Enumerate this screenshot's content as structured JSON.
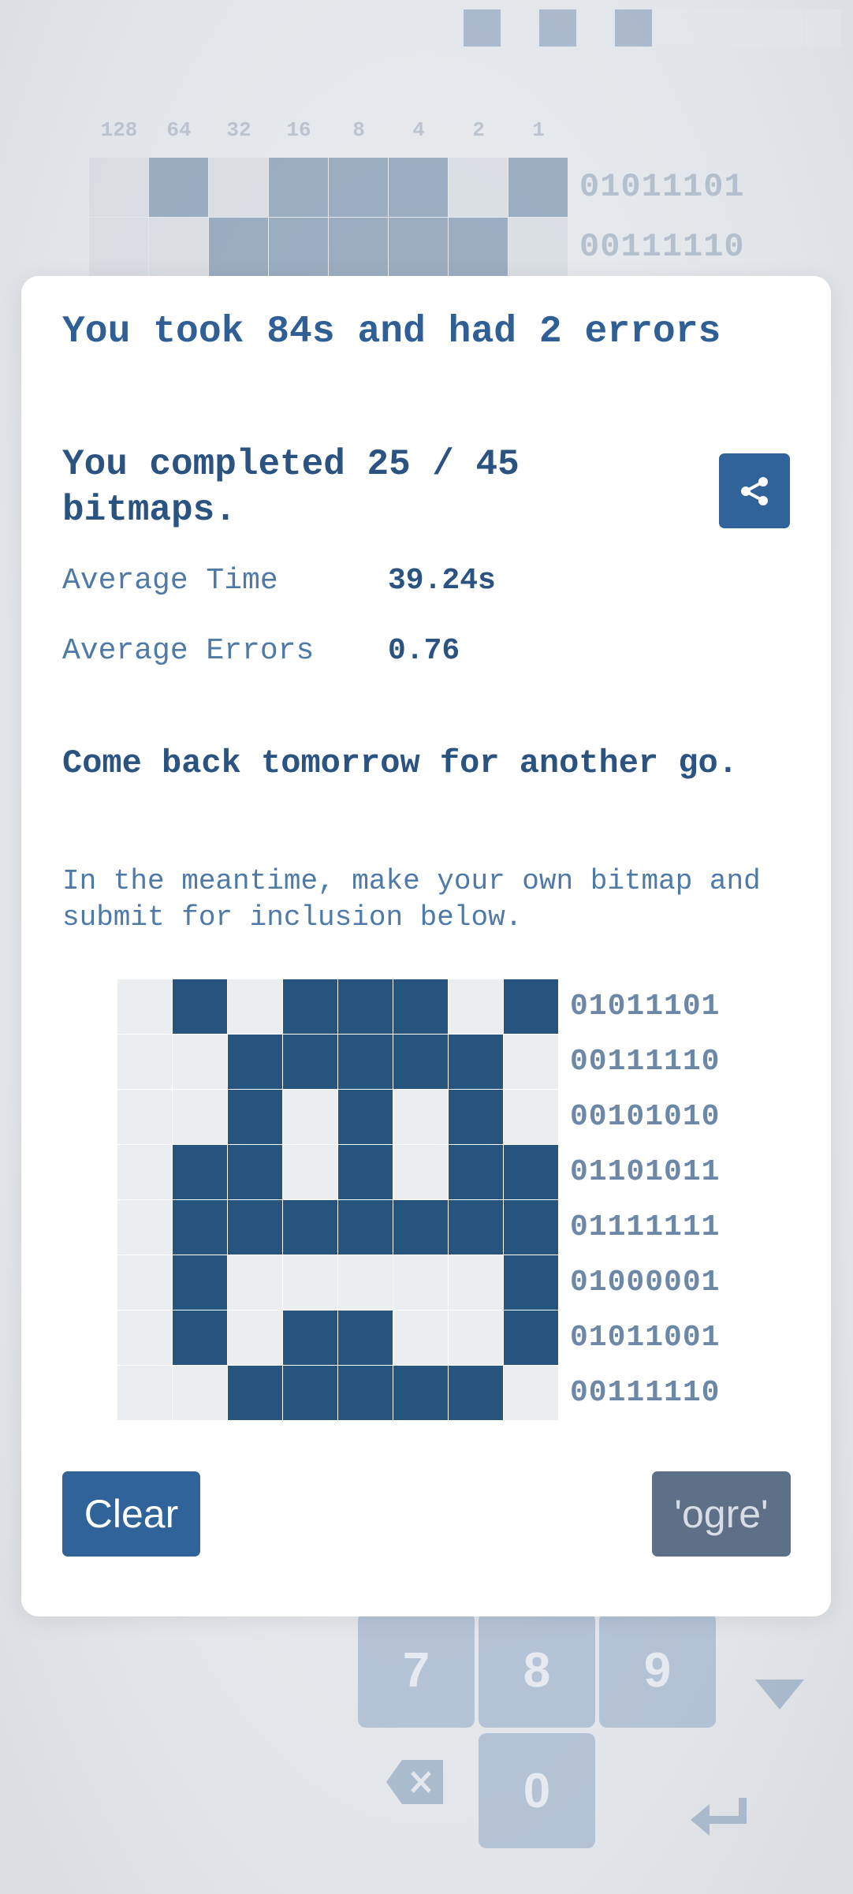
{
  "background": {
    "top_strip": [
      0,
      0,
      0,
      0,
      0,
      0,
      1,
      0,
      1,
      0,
      1,
      0,
      0,
      0,
      0,
      0
    ],
    "weights": [
      "128",
      "64",
      "32",
      "16",
      "8",
      "4",
      "2",
      "1"
    ],
    "rows": [
      {
        "bits": [
          0,
          1,
          0,
          1,
          1,
          1,
          0,
          1
        ],
        "code": "01011101"
      },
      {
        "bits": [
          0,
          0,
          1,
          1,
          1,
          1,
          1,
          0
        ],
        "code": "00111110"
      }
    ],
    "keypad": {
      "keys": [
        "7",
        "8",
        "9",
        "0"
      ],
      "icons": [
        "dropdown-arrow-icon",
        "backspace-icon",
        "enter-icon"
      ]
    }
  },
  "modal": {
    "result_line": "You took 84s and had 2 errors",
    "completed_line": "You completed 25 / 45 bitmaps.",
    "share_icon": "share-icon",
    "stats": [
      {
        "label": "Average Time",
        "value": "39.24s"
      },
      {
        "label": "Average Errors",
        "value": "0.76"
      }
    ],
    "come_back": "Come back tomorrow for another go.",
    "meantime": "In the meantime, make your own bitmap and submit for inclusion below.",
    "editor": [
      {
        "bits": [
          0,
          1,
          0,
          1,
          1,
          1,
          0,
          1
        ],
        "code": "01011101"
      },
      {
        "bits": [
          0,
          0,
          1,
          1,
          1,
          1,
          1,
          0
        ],
        "code": "00111110"
      },
      {
        "bits": [
          0,
          0,
          1,
          0,
          1,
          0,
          1,
          0
        ],
        "code": "00101010"
      },
      {
        "bits": [
          0,
          1,
          1,
          0,
          1,
          0,
          1,
          1
        ],
        "code": "01101011"
      },
      {
        "bits": [
          0,
          1,
          1,
          1,
          1,
          1,
          1,
          1
        ],
        "code": "01111111"
      },
      {
        "bits": [
          0,
          1,
          0,
          0,
          0,
          0,
          0,
          1
        ],
        "code": "01000001"
      },
      {
        "bits": [
          0,
          1,
          0,
          1,
          1,
          0,
          0,
          1
        ],
        "code": "01011001"
      },
      {
        "bits": [
          0,
          0,
          1,
          1,
          1,
          1,
          1,
          0
        ],
        "code": "00111110"
      }
    ],
    "clear_label": "Clear",
    "submit_label": "'ogre'"
  },
  "colors": {
    "primary": "#2f6399",
    "heading": "#2b5381",
    "cell_on": "#27547f",
    "cell_off": "#ebeef1"
  }
}
